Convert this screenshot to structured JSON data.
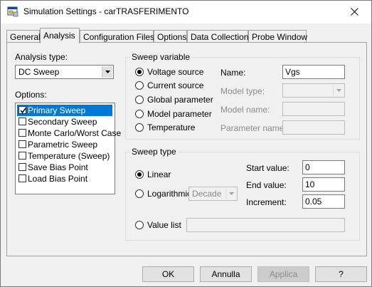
{
  "window": {
    "title": "Simulation Settings - carTRASFERIMENTO",
    "icon": "app-window-icon",
    "close_icon": "close-icon"
  },
  "tabs": [
    {
      "label": "General",
      "active": false
    },
    {
      "label": "Analysis",
      "active": true
    },
    {
      "label": "Configuration Files",
      "active": false
    },
    {
      "label": "Options",
      "active": false
    },
    {
      "label": "Data Collection",
      "active": false
    },
    {
      "label": "Probe Window",
      "active": false
    }
  ],
  "analysis": {
    "type_label": "Analysis type:",
    "type_value": "DC Sweep",
    "options_label": "Options:",
    "options": [
      {
        "label": "Primary Sweep",
        "checked": true,
        "selected": true
      },
      {
        "label": "Secondary Sweep",
        "checked": false,
        "selected": false
      },
      {
        "label": "Monte Carlo/Worst Case",
        "checked": false,
        "selected": false
      },
      {
        "label": "Parametric Sweep",
        "checked": false,
        "selected": false
      },
      {
        "label": "Temperature (Sweep)",
        "checked": false,
        "selected": false
      },
      {
        "label": "Save Bias Point",
        "checked": false,
        "selected": false
      },
      {
        "label": "Load Bias Point",
        "checked": false,
        "selected": false
      }
    ]
  },
  "sweep_variable": {
    "title": "Sweep variable",
    "radios": [
      {
        "label": "Voltage source",
        "selected": true
      },
      {
        "label": "Current source",
        "selected": false
      },
      {
        "label": "Global parameter",
        "selected": false
      },
      {
        "label": "Model parameter",
        "selected": false
      },
      {
        "label": "Temperature",
        "selected": false
      }
    ],
    "name_label": "Name:",
    "name_value": "Vgs",
    "model_type_label": "Model type:",
    "model_type_value": "",
    "model_name_label": "Model name:",
    "model_name_value": "",
    "parameter_name_label": "Parameter name:",
    "parameter_name_value": ""
  },
  "sweep_type": {
    "title": "Sweep type",
    "linear_label": "Linear",
    "linear_selected": true,
    "log_label": "Logarithmic",
    "log_selected": false,
    "log_scale_value": "Decade",
    "start_label": "Start value:",
    "start_value": "0",
    "end_label": "End value:",
    "end_value": "10",
    "increment_label": "Increment:",
    "increment_value": "0.05",
    "value_list_label": "Value list",
    "value_list_selected": false,
    "value_list_value": ""
  },
  "buttons": {
    "ok": "OK",
    "cancel": "Annulla",
    "apply": "Applica",
    "help": "?"
  }
}
